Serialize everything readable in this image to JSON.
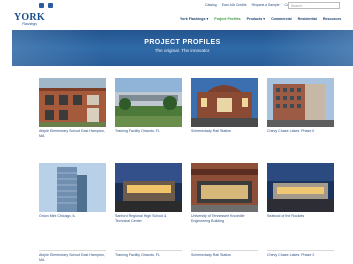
{
  "topbar": {
    "social": [
      "facebook-icon",
      "linkedin-icon"
    ],
    "links": [
      "Catalog",
      "Earn AIA Credits",
      "Request a Sample",
      "Contact Us"
    ],
    "search_placeholder": "Search..."
  },
  "nav": {
    "logo_word": "YORK",
    "logo_sub": "Flashings",
    "items": [
      "York Flashings ▾",
      "Project Profiles",
      "Products ▾",
      "Commercial",
      "Residential",
      "Resources"
    ],
    "active_index": 1
  },
  "hero": {
    "title": "PROJECT PROFILES",
    "subtitle": "The original. The innovator."
  },
  "projects": [
    {
      "caption": "Abiple Elementary School East Hampton, MA"
    },
    {
      "caption": "Training Facility Orlando, FL"
    },
    {
      "caption": "Schenectady Rail Station"
    },
    {
      "caption": "Chevy Chase Lakes: Phase II"
    },
    {
      "caption": "Onion Mint Chicago, IL"
    },
    {
      "caption": "Sanford Regional High School & Technical Center"
    },
    {
      "caption": "University of Tennessee Knoxville Engineering Building"
    },
    {
      "caption": "Seafood of the Rockies"
    },
    {
      "caption": "Abiple Elementary School East Hampton, MA"
    },
    {
      "caption": "Training Facility Orlando, FL"
    },
    {
      "caption": "Schenectady Rail Station"
    },
    {
      "caption": "Chevy Chase Lakes: Phase 2"
    }
  ],
  "colors": {
    "brand_blue": "#1c4f8f",
    "hero_blue": "#2a5d98",
    "active_green": "#3b9a3b",
    "caption_blue": "#2c4f80"
  }
}
